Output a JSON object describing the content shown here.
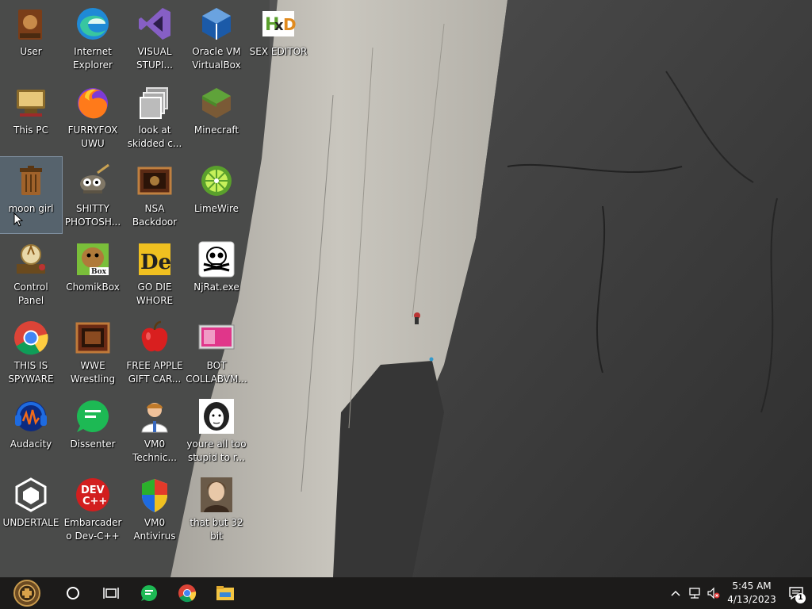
{
  "desktop": {
    "icons": [
      {
        "label": "User",
        "icon": "user-folder-icon"
      },
      {
        "label": "Internet Explorer",
        "icon": "edge-icon"
      },
      {
        "label": "VISUAL STUPI...",
        "icon": "visual-studio-icon"
      },
      {
        "label": "Oracle VM VirtualBox",
        "icon": "virtualbox-icon"
      },
      {
        "label": "SEX EDITOR",
        "icon": "hxd-icon"
      },
      {
        "label": "This PC",
        "icon": "this-pc-icon"
      },
      {
        "label": "FURRYFOX UWU",
        "icon": "firefox-icon"
      },
      {
        "label": "look at skidded c...",
        "icon": "shortcut-icon"
      },
      {
        "label": "Minecraft",
        "icon": "minecraft-icon"
      },
      {
        "label": "moon girl",
        "icon": "recycle-bin-icon",
        "selected": true
      },
      {
        "label": "SHITTY PHOTOSH...",
        "icon": "gimp-icon"
      },
      {
        "label": "NSA Backdoor",
        "icon": "nsa-icon"
      },
      {
        "label": "LimeWire",
        "icon": "limewire-icon"
      },
      {
        "label": "Control Panel",
        "icon": "control-panel-icon"
      },
      {
        "label": "ChomikBox",
        "icon": "chomikbox-icon"
      },
      {
        "label": "GO DIE WHORE",
        "icon": "godie-icon"
      },
      {
        "label": "NjRat.exe",
        "icon": "skull-icon"
      },
      {
        "label": "THIS IS SPYWARE",
        "icon": "chrome-icon"
      },
      {
        "label": "WWE Wrestling",
        "icon": "wwe-icon"
      },
      {
        "label": "FREE APPLE GIFT CAR...",
        "icon": "apple-icon"
      },
      {
        "label": "BOT COLLABVM...",
        "icon": "collabvm-icon"
      },
      {
        "label": "Audacity",
        "icon": "audacity-icon"
      },
      {
        "label": "Dissenter",
        "icon": "dissenter-icon"
      },
      {
        "label": "VM0 Technic...",
        "icon": "technician-icon"
      },
      {
        "label": "youre all too stupid to r...",
        "icon": "portrait-icon"
      },
      {
        "label": "UNDERTALE",
        "icon": "unity-icon"
      },
      {
        "label": "Embarcadero Dev-C++",
        "icon": "devcpp-icon"
      },
      {
        "label": "VM0 Antivirus",
        "icon": "antivirus-shield-icon"
      },
      {
        "label": "that but 32 bit",
        "icon": "portrait-woman-icon"
      }
    ]
  },
  "taskbar": {
    "buttons": [
      {
        "name": "start",
        "icon": "start-orb-icon"
      },
      {
        "name": "search",
        "icon": "cortana-icon"
      },
      {
        "name": "task-view",
        "icon": "task-view-icon"
      },
      {
        "name": "dissenter",
        "icon": "dissenter-icon"
      },
      {
        "name": "chrome",
        "icon": "chrome-icon"
      },
      {
        "name": "file-explorer",
        "icon": "file-explorer-icon"
      }
    ],
    "tray": {
      "time": "5:45 AM",
      "date": "4/13/2023",
      "notification_count": "1"
    }
  },
  "colors": {
    "taskbar_bg": "#1c1b1a",
    "label_text": "#ffffff"
  }
}
